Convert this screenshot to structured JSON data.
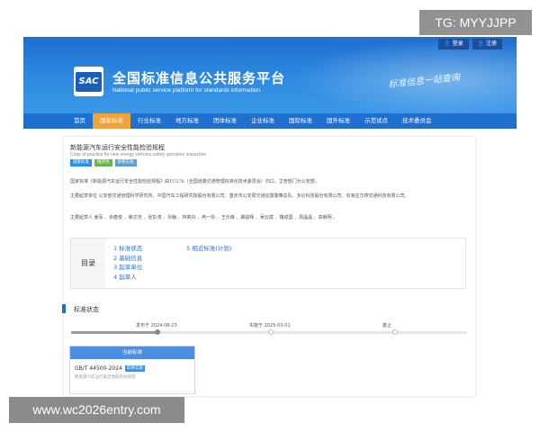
{
  "watermark": {
    "tag": "TG: MYYJJPP",
    "url": "www.wc2026entry.com"
  },
  "header": {
    "login": "登录",
    "register": "注册",
    "logo_text": "SAC",
    "title": "全国标准信息公共服务平台",
    "subtitle": "National public service platform  for standards information",
    "slogan": "标准信息一站查询",
    "bg_color": "#2f8ae0"
  },
  "nav": {
    "items": [
      "首页",
      "国家标准",
      "行业标准",
      "地方标准",
      "团体标准",
      "企业标准",
      "国际标准",
      "国外标准",
      "示范试点",
      "技术委员会"
    ],
    "active_index": 1,
    "active_color": "#f0a33a"
  },
  "standard": {
    "title": "新能源汽车运行安全性能检验规程",
    "title_en": "Code of practice for new energy vehicles safety operation inspection",
    "badges": [
      "国家标准",
      "推荐性",
      "即将实施"
    ],
    "para1": "国家标准《新能源汽车运行安全性能检验规程》由TC576（全国道路交通管理标准化技术委员会）归口，主管部门为公安部。",
    "para2": "主要起草单位 公安部交通管理科学研究所、中国汽车工程研究院股份有限公司、重庆市公安局交通巡警警察总队、多伦科技股份有限公司、石家庄华燕交通科技有限公司。",
    "para3": "主要起草人 姜军 、俞春俊 、赖文浩 、张彭涛 、孙巍 、林奕舟 、冉一彤 、王乐峰 、屠骏辉 、吴云斌 、魏成国 、周晶晶 、高朝明 。"
  },
  "toc": {
    "heading": "目录",
    "left": [
      "1 标准状态",
      "2 基础信息",
      "3 起草单位",
      "4 起草人"
    ],
    "right": [
      "5 相近标准(计划)"
    ]
  },
  "status": {
    "heading": "标准状态",
    "published": "发布于 2024-08-23",
    "effective": "实施于 2025-03-01",
    "abolished": "废止",
    "progress": 0.22
  },
  "current": {
    "heading": "当前标准",
    "code": "GB/T 44500-2024",
    "tag": "即将实施",
    "name": "新能源汽车运行安全性能检验规程"
  }
}
